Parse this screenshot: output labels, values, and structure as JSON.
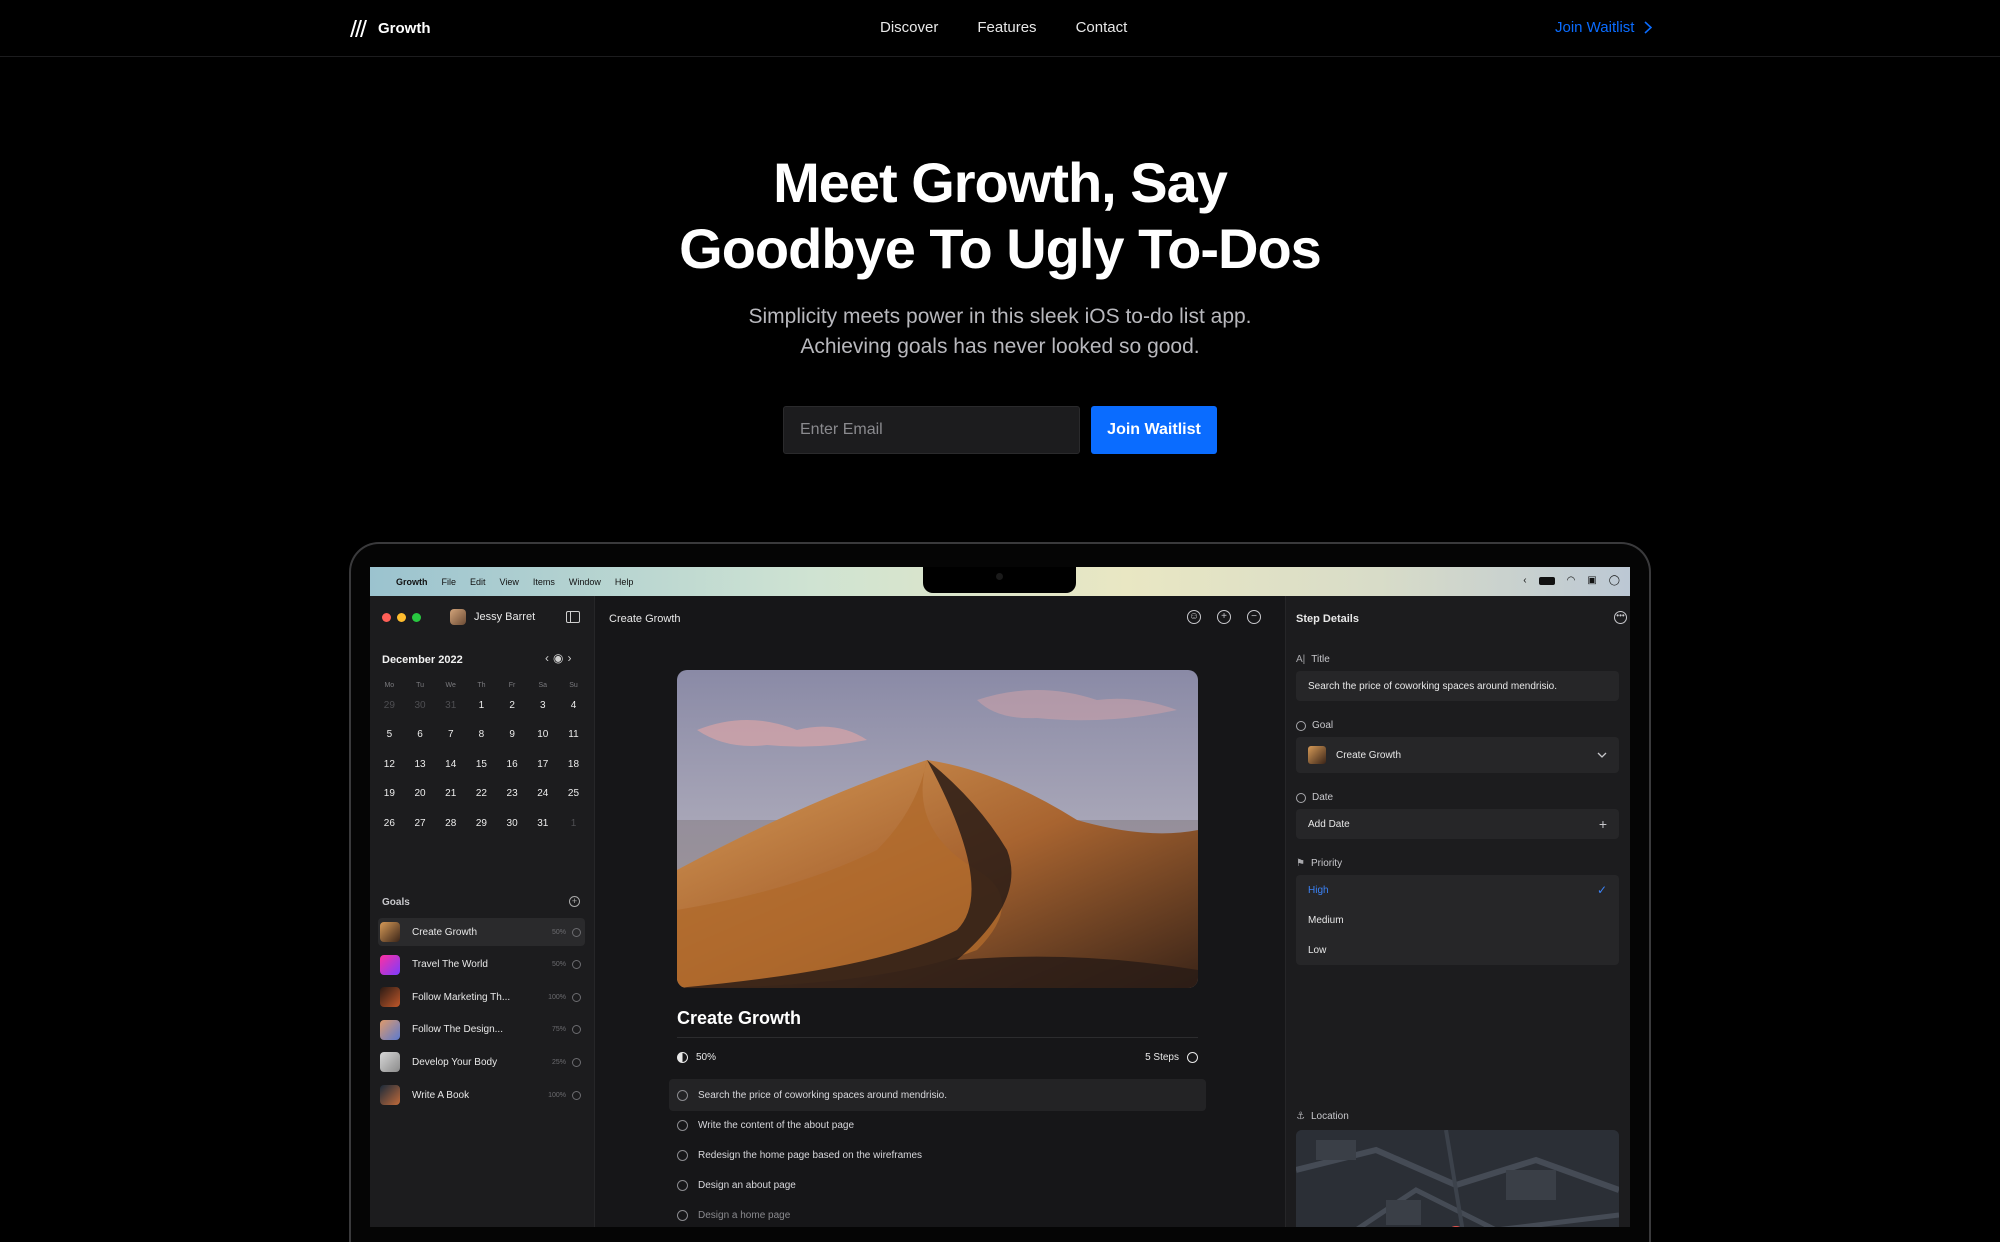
{
  "brand": {
    "name": "Growth"
  },
  "nav": {
    "links": [
      "Discover",
      "Features",
      "Contact"
    ],
    "cta": "Join Waitlist"
  },
  "hero": {
    "title_line1": "Meet Growth, Say",
    "title_line2": "Goodbye To Ugly To-Dos",
    "subtitle_line1": "Simplicity meets power in this sleek iOS to-do list app.",
    "subtitle_line2": "Achieving goals has never looked so good.",
    "email_placeholder": "Enter Email",
    "button": "Join Waitlist"
  },
  "app": {
    "menubar": {
      "app": "Growth",
      "items": [
        "File",
        "Edit",
        "View",
        "Items",
        "Window",
        "Help"
      ]
    },
    "user": "Jessy Barret",
    "calendar": {
      "month": "December 2022",
      "weekdays": [
        "Mo",
        "Tu",
        "We",
        "Th",
        "Fr",
        "Sa",
        "Su"
      ],
      "days": [
        "29",
        "30",
        "31",
        "1",
        "2",
        "3",
        "4",
        "5",
        "6",
        "7",
        "8",
        "9",
        "10",
        "11",
        "12",
        "13",
        "14",
        "15",
        "16",
        "17",
        "18",
        "19",
        "20",
        "21",
        "22",
        "23",
        "24",
        "25",
        "26",
        "27",
        "28",
        "29",
        "30",
        "31",
        "1"
      ]
    },
    "goals_header": "Goals",
    "goals": [
      {
        "label": "Create Growth",
        "pct": "50%"
      },
      {
        "label": "Travel The World",
        "pct": "50%"
      },
      {
        "label": "Follow Marketing Th...",
        "pct": "100%"
      },
      {
        "label": "Follow The Design...",
        "pct": "75%"
      },
      {
        "label": "Develop Your Body",
        "pct": "25%"
      },
      {
        "label": "Write A Book",
        "pct": "100%"
      }
    ],
    "main": {
      "title": "Create Growth",
      "goal_title": "Create Growth",
      "progress": "50%",
      "steps": "5 Steps",
      "tasks": [
        "Search the price of coworking spaces around mendrisio.",
        "Write the content of the about page",
        "Redesign the home page based on the wireframes",
        "Design an about page",
        "Design a home page"
      ]
    },
    "details": {
      "header": "Step Details",
      "title_label": "Title",
      "title_value": "Search the price of coworking spaces around mendrisio.",
      "goal_label": "Goal",
      "goal_value": "Create Growth",
      "date_label": "Date",
      "date_value": "Add Date",
      "priority_label": "Priority",
      "priority_options": [
        "High",
        "Medium",
        "Low"
      ],
      "location_label": "Location"
    }
  },
  "colors": {
    "accent": "#0a6cff",
    "background": "#000000"
  }
}
